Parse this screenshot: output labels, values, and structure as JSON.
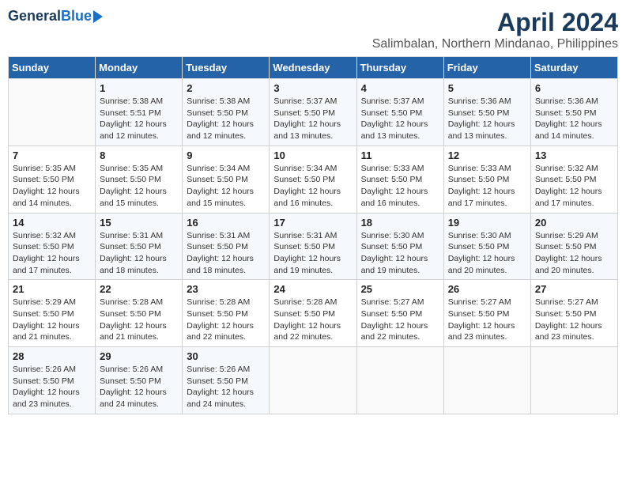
{
  "logo": {
    "general": "General",
    "blue": "Blue"
  },
  "title": "April 2024",
  "subtitle": "Salimbalan, Northern Mindanao, Philippines",
  "days_of_week": [
    "Sunday",
    "Monday",
    "Tuesday",
    "Wednesday",
    "Thursday",
    "Friday",
    "Saturday"
  ],
  "weeks": [
    [
      {
        "day": "",
        "info": ""
      },
      {
        "day": "1",
        "info": "Sunrise: 5:38 AM\nSunset: 5:51 PM\nDaylight: 12 hours\nand 12 minutes."
      },
      {
        "day": "2",
        "info": "Sunrise: 5:38 AM\nSunset: 5:50 PM\nDaylight: 12 hours\nand 12 minutes."
      },
      {
        "day": "3",
        "info": "Sunrise: 5:37 AM\nSunset: 5:50 PM\nDaylight: 12 hours\nand 13 minutes."
      },
      {
        "day": "4",
        "info": "Sunrise: 5:37 AM\nSunset: 5:50 PM\nDaylight: 12 hours\nand 13 minutes."
      },
      {
        "day": "5",
        "info": "Sunrise: 5:36 AM\nSunset: 5:50 PM\nDaylight: 12 hours\nand 13 minutes."
      },
      {
        "day": "6",
        "info": "Sunrise: 5:36 AM\nSunset: 5:50 PM\nDaylight: 12 hours\nand 14 minutes."
      }
    ],
    [
      {
        "day": "7",
        "info": "Sunrise: 5:35 AM\nSunset: 5:50 PM\nDaylight: 12 hours\nand 14 minutes."
      },
      {
        "day": "8",
        "info": "Sunrise: 5:35 AM\nSunset: 5:50 PM\nDaylight: 12 hours\nand 15 minutes."
      },
      {
        "day": "9",
        "info": "Sunrise: 5:34 AM\nSunset: 5:50 PM\nDaylight: 12 hours\nand 15 minutes."
      },
      {
        "day": "10",
        "info": "Sunrise: 5:34 AM\nSunset: 5:50 PM\nDaylight: 12 hours\nand 16 minutes."
      },
      {
        "day": "11",
        "info": "Sunrise: 5:33 AM\nSunset: 5:50 PM\nDaylight: 12 hours\nand 16 minutes."
      },
      {
        "day": "12",
        "info": "Sunrise: 5:33 AM\nSunset: 5:50 PM\nDaylight: 12 hours\nand 17 minutes."
      },
      {
        "day": "13",
        "info": "Sunrise: 5:32 AM\nSunset: 5:50 PM\nDaylight: 12 hours\nand 17 minutes."
      }
    ],
    [
      {
        "day": "14",
        "info": "Sunrise: 5:32 AM\nSunset: 5:50 PM\nDaylight: 12 hours\nand 17 minutes."
      },
      {
        "day": "15",
        "info": "Sunrise: 5:31 AM\nSunset: 5:50 PM\nDaylight: 12 hours\nand 18 minutes."
      },
      {
        "day": "16",
        "info": "Sunrise: 5:31 AM\nSunset: 5:50 PM\nDaylight: 12 hours\nand 18 minutes."
      },
      {
        "day": "17",
        "info": "Sunrise: 5:31 AM\nSunset: 5:50 PM\nDaylight: 12 hours\nand 19 minutes."
      },
      {
        "day": "18",
        "info": "Sunrise: 5:30 AM\nSunset: 5:50 PM\nDaylight: 12 hours\nand 19 minutes."
      },
      {
        "day": "19",
        "info": "Sunrise: 5:30 AM\nSunset: 5:50 PM\nDaylight: 12 hours\nand 20 minutes."
      },
      {
        "day": "20",
        "info": "Sunrise: 5:29 AM\nSunset: 5:50 PM\nDaylight: 12 hours\nand 20 minutes."
      }
    ],
    [
      {
        "day": "21",
        "info": "Sunrise: 5:29 AM\nSunset: 5:50 PM\nDaylight: 12 hours\nand 21 minutes."
      },
      {
        "day": "22",
        "info": "Sunrise: 5:28 AM\nSunset: 5:50 PM\nDaylight: 12 hours\nand 21 minutes."
      },
      {
        "day": "23",
        "info": "Sunrise: 5:28 AM\nSunset: 5:50 PM\nDaylight: 12 hours\nand 22 minutes."
      },
      {
        "day": "24",
        "info": "Sunrise: 5:28 AM\nSunset: 5:50 PM\nDaylight: 12 hours\nand 22 minutes."
      },
      {
        "day": "25",
        "info": "Sunrise: 5:27 AM\nSunset: 5:50 PM\nDaylight: 12 hours\nand 22 minutes."
      },
      {
        "day": "26",
        "info": "Sunrise: 5:27 AM\nSunset: 5:50 PM\nDaylight: 12 hours\nand 23 minutes."
      },
      {
        "day": "27",
        "info": "Sunrise: 5:27 AM\nSunset: 5:50 PM\nDaylight: 12 hours\nand 23 minutes."
      }
    ],
    [
      {
        "day": "28",
        "info": "Sunrise: 5:26 AM\nSunset: 5:50 PM\nDaylight: 12 hours\nand 23 minutes."
      },
      {
        "day": "29",
        "info": "Sunrise: 5:26 AM\nSunset: 5:50 PM\nDaylight: 12 hours\nand 24 minutes."
      },
      {
        "day": "30",
        "info": "Sunrise: 5:26 AM\nSunset: 5:50 PM\nDaylight: 12 hours\nand 24 minutes."
      },
      {
        "day": "",
        "info": ""
      },
      {
        "day": "",
        "info": ""
      },
      {
        "day": "",
        "info": ""
      },
      {
        "day": "",
        "info": ""
      }
    ]
  ]
}
